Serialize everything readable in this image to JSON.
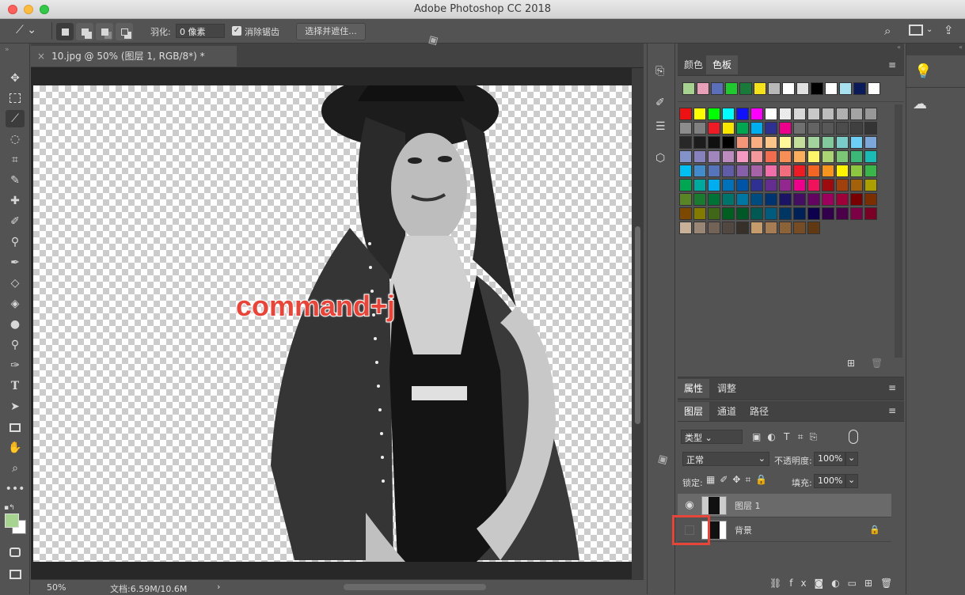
{
  "window": {
    "title": "Adobe Photoshop CC 2018"
  },
  "options_bar": {
    "feather_label": "羽化:",
    "feather_value": "0 像素",
    "antialias_label": "消除锯齿",
    "select_mask_button": "选择并遮住..."
  },
  "document": {
    "tab_title": "10.jpg @ 50% (图层 1, RGB/8*) *",
    "annotation": "command+j",
    "zoom": "50%",
    "doc_info": "文档:6.59M/10.6M"
  },
  "swatches_panel": {
    "tabs": [
      "颜色",
      "色板"
    ],
    "recent": [
      "#a6d38f",
      "#e8a0b8",
      "#5a6fb8",
      "#22c830",
      "#1a7a3a",
      "#f5e21a",
      "#b8b8b8",
      "#ffffff",
      "#e0e0e0",
      "#000000",
      "#ffffff",
      "#a8e0f0",
      "#0a1a5a",
      "#ffffff"
    ],
    "grid": [
      [
        "#ee1111",
        "#ffff00",
        "#00ff00",
        "#00ffff",
        "#1111ff",
        "#ff00ff",
        "#ffffff",
        "#ebebeb",
        "#d8d8d8",
        "#c8c8c8",
        "#bcbcbc",
        "#b0b0b0",
        "#a4a4a4",
        "#989898"
      ],
      [
        "#8c8c8c",
        "#808080",
        "#ee1c24",
        "#f7e500",
        "#00a650",
        "#00aeef",
        "#2e3192",
        "#ec008c",
        "#707070",
        "#646464",
        "#585858",
        "#4c4c4c",
        "#404040",
        "#343434"
      ],
      [
        "#282828",
        "#1c1c1c",
        "#101010",
        "#000000",
        "#f69679",
        "#f9ad81",
        "#fdc689",
        "#fff799",
        "#c4df9b",
        "#a3d39c",
        "#82ca9c",
        "#7accc8",
        "#6dcff6",
        "#7da7d9"
      ],
      [
        "#8393ca",
        "#8781bd",
        "#a186be",
        "#bd8cbf",
        "#f49ac2",
        "#f5989d",
        "#f26c4f",
        "#f68e56",
        "#fbaf5d",
        "#fff568",
        "#acd373",
        "#7cc576",
        "#3bb878",
        "#1abbb4"
      ],
      [
        "#00bff3",
        "#438ccb",
        "#5574b9",
        "#605ca8",
        "#855fa8",
        "#a763a8",
        "#f06eaa",
        "#f26d7d",
        "#ed1c24",
        "#f26522",
        "#f7941d",
        "#fff200",
        "#8dc63f",
        "#39b54a"
      ],
      [
        "#00a651",
        "#00a99d",
        "#00aeef",
        "#0072bc",
        "#0054a6",
        "#2e3192",
        "#662d91",
        "#92278f",
        "#ec008c",
        "#ed145b",
        "#9e0b0f",
        "#a0410d",
        "#a36209",
        "#aba000"
      ],
      [
        "#598527",
        "#1a7b30",
        "#007236",
        "#00746b",
        "#0076a3",
        "#004b80",
        "#003471",
        "#1b1464",
        "#440e62",
        "#630460",
        "#9e005d",
        "#9e0039",
        "#790000",
        "#7b2e00"
      ],
      [
        "#7d4900",
        "#827b00",
        "#406618",
        "#005e20",
        "#005826",
        "#005952",
        "#005b7f",
        "#003663",
        "#002157",
        "#0d004c",
        "#32004b",
        "#4b0049",
        "#7b0046",
        "#7a0026"
      ],
      [
        "#c7b299",
        "#998675",
        "#736357",
        "#534741",
        "#37302a",
        "#c69c6d",
        "#a67c52",
        "#8c6239",
        "#754c24",
        "#603913"
      ]
    ]
  },
  "properties_panel": {
    "tabs": [
      "属性",
      "调整"
    ]
  },
  "layers_panel": {
    "tabs": [
      "图层",
      "通道",
      "路径"
    ],
    "filter_kind": "类型",
    "blend_mode": "正常",
    "opacity_label": "不透明度:",
    "opacity_value": "100%",
    "lock_label": "锁定:",
    "fill_label": "填充:",
    "fill_value": "100%",
    "layers": [
      {
        "name": "图层 1",
        "visible": true,
        "selected": true
      },
      {
        "name": "背景",
        "visible": false,
        "selected": false
      }
    ]
  },
  "colors": {
    "highlight_box": "#e8453a",
    "annotation": "#e8453a",
    "foreground": "#a6d38f"
  }
}
